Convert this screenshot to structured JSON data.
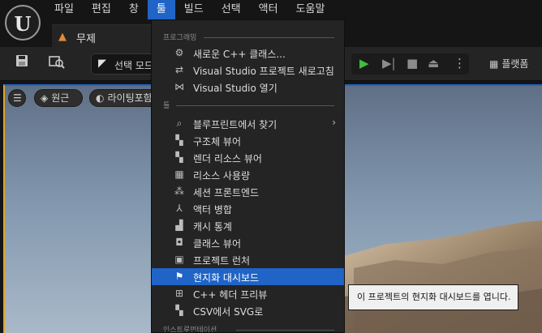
{
  "app": {
    "logo_glyph": "U",
    "document_tab": "무제"
  },
  "menubar": [
    {
      "label": "파일",
      "active": false
    },
    {
      "label": "편집",
      "active": false
    },
    {
      "label": "창",
      "active": false
    },
    {
      "label": "툴",
      "active": true
    },
    {
      "label": "빌드",
      "active": false
    },
    {
      "label": "선택",
      "active": false
    },
    {
      "label": "액터",
      "active": false
    },
    {
      "label": "도움말",
      "active": false
    }
  ],
  "toolbar": {
    "mode_select": "선택 모드",
    "platforms": "플랫폼"
  },
  "viewport": {
    "perspective_pill": "원근",
    "lighting_pill": "라이팅포함"
  },
  "tools_menu": {
    "sections": [
      {
        "label": "프로그래밍",
        "items": [
          {
            "label": "새로운 C++ 클래스...",
            "icon": "add-cpp-class-icon"
          },
          {
            "label": "Visual Studio 프로젝트 새로고침",
            "icon": "refresh-project-icon"
          },
          {
            "label": "Visual Studio 열기",
            "icon": "visual-studio-icon"
          }
        ]
      },
      {
        "label": "툴",
        "items": [
          {
            "label": "블루프린트에서 찾기",
            "icon": "find-in-blueprint-icon",
            "submenu": true
          },
          {
            "label": "구조체 뷰어",
            "icon": "struct-viewer-icon"
          },
          {
            "label": "렌더 리소스 뷰어",
            "icon": "render-resource-icon"
          },
          {
            "label": "리소스 사용량",
            "icon": "resource-usage-icon"
          },
          {
            "label": "세션 프론트엔드",
            "icon": "session-frontend-icon"
          },
          {
            "label": "액터 병합",
            "icon": "merge-actors-icon"
          },
          {
            "label": "캐시 통계",
            "icon": "cache-stats-icon"
          },
          {
            "label": "클래스 뷰어",
            "icon": "class-viewer-icon"
          },
          {
            "label": "프로젝트 런처",
            "icon": "project-launcher-icon"
          },
          {
            "label": "현지화 대시보드",
            "icon": "localization-flag-icon",
            "highlighted": true
          },
          {
            "label": "C++ 헤더 프리뷰",
            "icon": "header-preview-icon"
          },
          {
            "label": "CSV에서 SVG로",
            "icon": "csv-to-svg-icon"
          }
        ]
      },
      {
        "label": "인스트루먼테이션",
        "items": []
      }
    ]
  },
  "tooltip": {
    "text": "이 프로젝트의 현지화 대시보드를 엽니다."
  },
  "colors": {
    "accent": "#1f64c6",
    "play_green": "#3fbf3f",
    "tab_orange": "#e08a3a"
  }
}
